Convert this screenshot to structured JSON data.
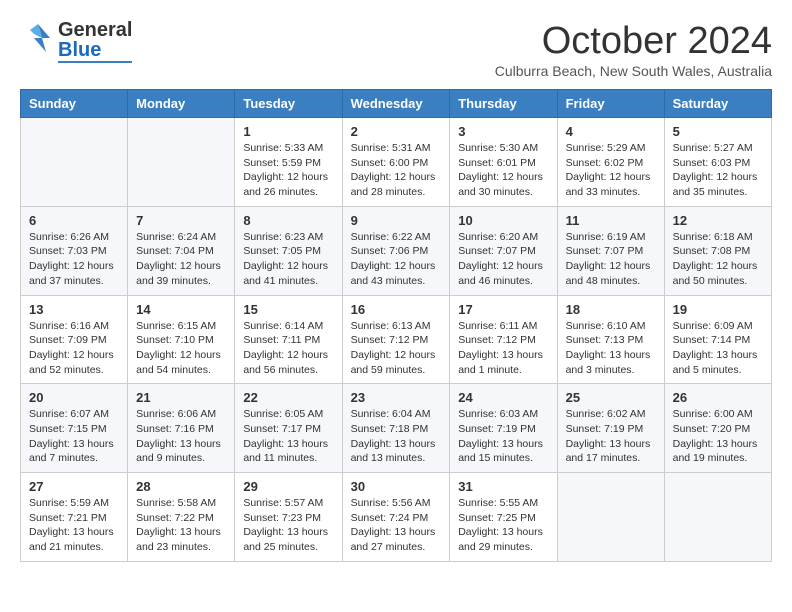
{
  "header": {
    "logo": {
      "general": "General",
      "blue": "Blue"
    },
    "title": "October 2024",
    "subtitle": "Culburra Beach, New South Wales, Australia"
  },
  "days": [
    "Sunday",
    "Monday",
    "Tuesday",
    "Wednesday",
    "Thursday",
    "Friday",
    "Saturday"
  ],
  "weeks": [
    [
      {
        "num": "",
        "lines": []
      },
      {
        "num": "",
        "lines": []
      },
      {
        "num": "1",
        "lines": [
          "Sunrise: 5:33 AM",
          "Sunset: 5:59 PM",
          "Daylight: 12 hours",
          "and 26 minutes."
        ]
      },
      {
        "num": "2",
        "lines": [
          "Sunrise: 5:31 AM",
          "Sunset: 6:00 PM",
          "Daylight: 12 hours",
          "and 28 minutes."
        ]
      },
      {
        "num": "3",
        "lines": [
          "Sunrise: 5:30 AM",
          "Sunset: 6:01 PM",
          "Daylight: 12 hours",
          "and 30 minutes."
        ]
      },
      {
        "num": "4",
        "lines": [
          "Sunrise: 5:29 AM",
          "Sunset: 6:02 PM",
          "Daylight: 12 hours",
          "and 33 minutes."
        ]
      },
      {
        "num": "5",
        "lines": [
          "Sunrise: 5:27 AM",
          "Sunset: 6:03 PM",
          "Daylight: 12 hours",
          "and 35 minutes."
        ]
      }
    ],
    [
      {
        "num": "6",
        "lines": [
          "Sunrise: 6:26 AM",
          "Sunset: 7:03 PM",
          "Daylight: 12 hours",
          "and 37 minutes."
        ]
      },
      {
        "num": "7",
        "lines": [
          "Sunrise: 6:24 AM",
          "Sunset: 7:04 PM",
          "Daylight: 12 hours",
          "and 39 minutes."
        ]
      },
      {
        "num": "8",
        "lines": [
          "Sunrise: 6:23 AM",
          "Sunset: 7:05 PM",
          "Daylight: 12 hours",
          "and 41 minutes."
        ]
      },
      {
        "num": "9",
        "lines": [
          "Sunrise: 6:22 AM",
          "Sunset: 7:06 PM",
          "Daylight: 12 hours",
          "and 43 minutes."
        ]
      },
      {
        "num": "10",
        "lines": [
          "Sunrise: 6:20 AM",
          "Sunset: 7:07 PM",
          "Daylight: 12 hours",
          "and 46 minutes."
        ]
      },
      {
        "num": "11",
        "lines": [
          "Sunrise: 6:19 AM",
          "Sunset: 7:07 PM",
          "Daylight: 12 hours",
          "and 48 minutes."
        ]
      },
      {
        "num": "12",
        "lines": [
          "Sunrise: 6:18 AM",
          "Sunset: 7:08 PM",
          "Daylight: 12 hours",
          "and 50 minutes."
        ]
      }
    ],
    [
      {
        "num": "13",
        "lines": [
          "Sunrise: 6:16 AM",
          "Sunset: 7:09 PM",
          "Daylight: 12 hours",
          "and 52 minutes."
        ]
      },
      {
        "num": "14",
        "lines": [
          "Sunrise: 6:15 AM",
          "Sunset: 7:10 PM",
          "Daylight: 12 hours",
          "and 54 minutes."
        ]
      },
      {
        "num": "15",
        "lines": [
          "Sunrise: 6:14 AM",
          "Sunset: 7:11 PM",
          "Daylight: 12 hours",
          "and 56 minutes."
        ]
      },
      {
        "num": "16",
        "lines": [
          "Sunrise: 6:13 AM",
          "Sunset: 7:12 PM",
          "Daylight: 12 hours",
          "and 59 minutes."
        ]
      },
      {
        "num": "17",
        "lines": [
          "Sunrise: 6:11 AM",
          "Sunset: 7:12 PM",
          "Daylight: 13 hours",
          "and 1 minute."
        ]
      },
      {
        "num": "18",
        "lines": [
          "Sunrise: 6:10 AM",
          "Sunset: 7:13 PM",
          "Daylight: 13 hours",
          "and 3 minutes."
        ]
      },
      {
        "num": "19",
        "lines": [
          "Sunrise: 6:09 AM",
          "Sunset: 7:14 PM",
          "Daylight: 13 hours",
          "and 5 minutes."
        ]
      }
    ],
    [
      {
        "num": "20",
        "lines": [
          "Sunrise: 6:07 AM",
          "Sunset: 7:15 PM",
          "Daylight: 13 hours",
          "and 7 minutes."
        ]
      },
      {
        "num": "21",
        "lines": [
          "Sunrise: 6:06 AM",
          "Sunset: 7:16 PM",
          "Daylight: 13 hours",
          "and 9 minutes."
        ]
      },
      {
        "num": "22",
        "lines": [
          "Sunrise: 6:05 AM",
          "Sunset: 7:17 PM",
          "Daylight: 13 hours",
          "and 11 minutes."
        ]
      },
      {
        "num": "23",
        "lines": [
          "Sunrise: 6:04 AM",
          "Sunset: 7:18 PM",
          "Daylight: 13 hours",
          "and 13 minutes."
        ]
      },
      {
        "num": "24",
        "lines": [
          "Sunrise: 6:03 AM",
          "Sunset: 7:19 PM",
          "Daylight: 13 hours",
          "and 15 minutes."
        ]
      },
      {
        "num": "25",
        "lines": [
          "Sunrise: 6:02 AM",
          "Sunset: 7:19 PM",
          "Daylight: 13 hours",
          "and 17 minutes."
        ]
      },
      {
        "num": "26",
        "lines": [
          "Sunrise: 6:00 AM",
          "Sunset: 7:20 PM",
          "Daylight: 13 hours",
          "and 19 minutes."
        ]
      }
    ],
    [
      {
        "num": "27",
        "lines": [
          "Sunrise: 5:59 AM",
          "Sunset: 7:21 PM",
          "Daylight: 13 hours",
          "and 21 minutes."
        ]
      },
      {
        "num": "28",
        "lines": [
          "Sunrise: 5:58 AM",
          "Sunset: 7:22 PM",
          "Daylight: 13 hours",
          "and 23 minutes."
        ]
      },
      {
        "num": "29",
        "lines": [
          "Sunrise: 5:57 AM",
          "Sunset: 7:23 PM",
          "Daylight: 13 hours",
          "and 25 minutes."
        ]
      },
      {
        "num": "30",
        "lines": [
          "Sunrise: 5:56 AM",
          "Sunset: 7:24 PM",
          "Daylight: 13 hours",
          "and 27 minutes."
        ]
      },
      {
        "num": "31",
        "lines": [
          "Sunrise: 5:55 AM",
          "Sunset: 7:25 PM",
          "Daylight: 13 hours",
          "and 29 minutes."
        ]
      },
      {
        "num": "",
        "lines": []
      },
      {
        "num": "",
        "lines": []
      }
    ]
  ]
}
